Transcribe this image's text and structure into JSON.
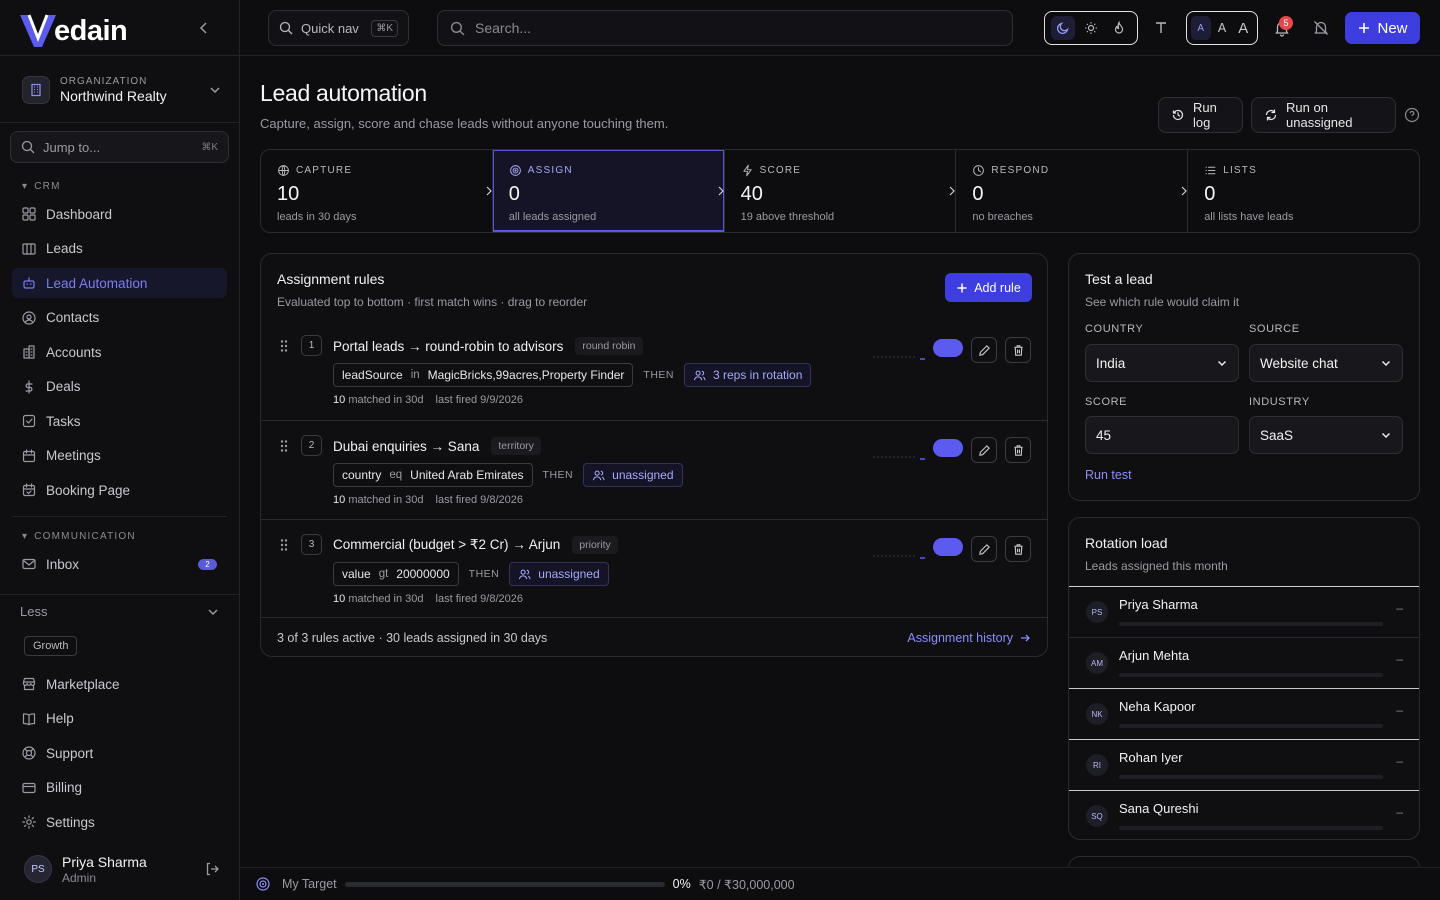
{
  "brand": {
    "name": "edain"
  },
  "org": {
    "label": "ORGANIZATION",
    "name": "Northwind Realty"
  },
  "jump": {
    "placeholder": "Jump to...",
    "shortcut": "⌘K"
  },
  "sections": {
    "crm": "CRM",
    "communication": "COMMUNICATION"
  },
  "nav_crm": [
    {
      "label": "Dashboard",
      "icon": "grid-icon"
    },
    {
      "label": "Leads",
      "icon": "columns-icon"
    },
    {
      "label": "Lead Automation",
      "icon": "bot-icon",
      "active": true
    },
    {
      "label": "Contacts",
      "icon": "contact-icon"
    },
    {
      "label": "Accounts",
      "icon": "building-icon"
    },
    {
      "label": "Deals",
      "icon": "dollar-icon"
    },
    {
      "label": "Tasks",
      "icon": "checkbox-icon"
    },
    {
      "label": "Meetings",
      "icon": "calendar-icon"
    },
    {
      "label": "Booking Page",
      "icon": "calendar-check-icon"
    }
  ],
  "nav_comm": [
    {
      "label": "Inbox",
      "icon": "mail-icon",
      "badge": "2"
    }
  ],
  "less": {
    "label": "Less",
    "tag": "Growth"
  },
  "nav_bottom": [
    {
      "label": "Marketplace",
      "icon": "store-icon"
    },
    {
      "label": "Help",
      "icon": "book-icon"
    },
    {
      "label": "Support",
      "icon": "lifebuoy-icon"
    },
    {
      "label": "Billing",
      "icon": "card-icon"
    },
    {
      "label": "Settings",
      "icon": "gear-icon"
    }
  ],
  "user": {
    "initials": "PS",
    "name": "Priya Sharma",
    "role": "Admin"
  },
  "topbar": {
    "quicknav": "Quick nav",
    "quicknav_kbd": "⌘K",
    "search_placeholder": "Search...",
    "size_labels": [
      "A",
      "A",
      "A"
    ],
    "notif_count": "5",
    "new_label": "New"
  },
  "page": {
    "title": "Lead automation",
    "subtitle": "Capture, assign, score and chase leads without anyone touching them.",
    "run_log": "Run log",
    "run_unassigned": "Run on unassigned"
  },
  "stages": [
    {
      "label": "CAPTURE",
      "value": "10",
      "sub": "leads in 30 days",
      "icon": "globe-icon"
    },
    {
      "label": "ASSIGN",
      "value": "0",
      "sub": "all leads assigned",
      "icon": "target-icon",
      "active": true
    },
    {
      "label": "SCORE",
      "value": "40",
      "sub": "19 above threshold",
      "icon": "bolt-icon"
    },
    {
      "label": "RESPOND",
      "value": "0",
      "sub": "no breaches",
      "icon": "clock-icon"
    },
    {
      "label": "LISTS",
      "value": "0",
      "sub": "all lists have leads",
      "icon": "list-icon"
    }
  ],
  "rules_card": {
    "title": "Assignment rules",
    "subtitle": "Evaluated top to bottom · first match wins · drag to reorder",
    "add_rule": "Add rule",
    "then_label": "THEN",
    "matched_suffix": "matched in 30d",
    "footer": "3 of 3 rules active · 30 leads assigned in 30 days",
    "history": "Assignment history",
    "rules": [
      {
        "num": "1",
        "title": "Portal leads → round-robin to advisors",
        "tag": "round robin",
        "field": "leadSource",
        "op": "in",
        "value": "MagicBricks,99acres,Property Finder",
        "assign": "3 reps in rotation",
        "matched": "10",
        "last": "last fired 9/9/2026"
      },
      {
        "num": "2",
        "title": "Dubai enquiries → Sana",
        "tag": "territory",
        "field": "country",
        "op": "eq",
        "value": "United Arab Emirates",
        "assign": "unassigned",
        "matched": "10",
        "last": "last fired 9/8/2026"
      },
      {
        "num": "3",
        "title": "Commercial (budget > ₹2 Cr) → Arjun",
        "tag": "priority",
        "field": "value",
        "op": "gt",
        "value": "20000000",
        "assign": "unassigned",
        "matched": "10",
        "last": "last fired 9/8/2026"
      }
    ]
  },
  "test_card": {
    "title": "Test a lead",
    "subtitle": "See which rule would claim it",
    "country_label": "COUNTRY",
    "country": "India",
    "source_label": "SOURCE",
    "source": "Website chat",
    "score_label": "SCORE",
    "score": "45",
    "industry_label": "INDUSTRY",
    "industry": "SaaS",
    "run": "Run test"
  },
  "rotation_card": {
    "title": "Rotation load",
    "subtitle": "Leads assigned this month",
    "reps": [
      {
        "initials": "PS",
        "name": "Priya Sharma",
        "value": "–",
        "load": 0
      },
      {
        "initials": "AM",
        "name": "Arjun Mehta",
        "value": "–",
        "load": 0
      },
      {
        "initials": "NK",
        "name": "Neha Kapoor",
        "value": "–",
        "load": 0
      },
      {
        "initials": "RI",
        "name": "Rohan Iyer",
        "value": "–",
        "load": 0
      },
      {
        "initials": "SQ",
        "name": "Sana Qureshi",
        "value": "–",
        "load": 0
      }
    ]
  },
  "footer": {
    "label": "My Target",
    "progress": 0,
    "pct": "0%",
    "amount": "₹0 / ₹30,000,000"
  },
  "colors": {
    "accent": "#3d3de0",
    "accent_text": "#8d8df8",
    "bg": "#0d0d10",
    "border": "#2a2a31"
  }
}
